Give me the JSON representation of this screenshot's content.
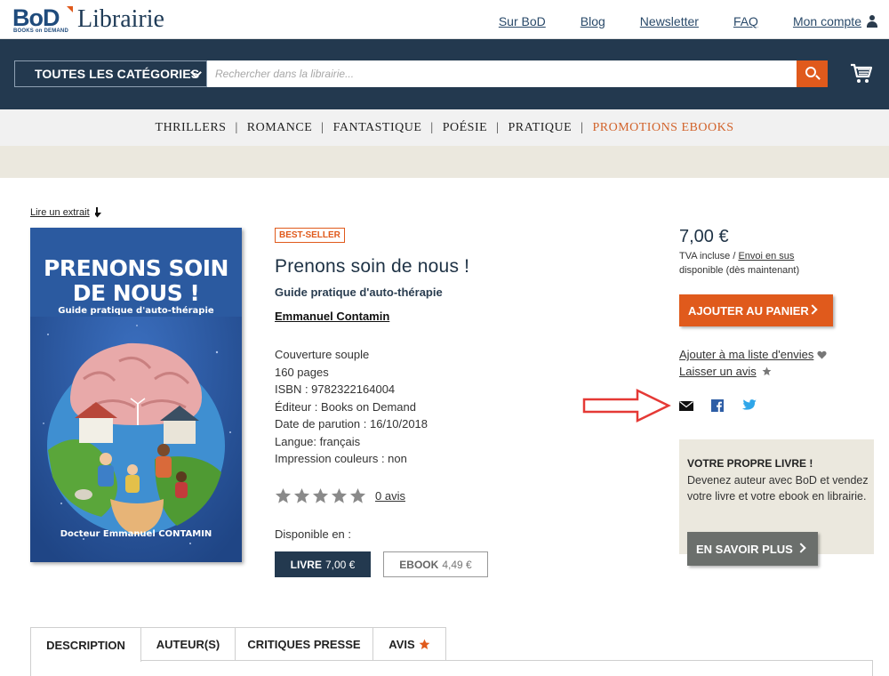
{
  "header": {
    "logo_brand": "BoD",
    "logo_sub": "BOOKS on DEMAND",
    "logo_title": "Librairie",
    "links": [
      "Sur BoD",
      "Blog",
      "Newsletter",
      "FAQ"
    ],
    "account_label": "Mon compte"
  },
  "search": {
    "category_label": "TOUTES LES CATÉGORIES",
    "placeholder": "Rechercher dans la librairie..."
  },
  "category_nav": {
    "items": [
      "THRILLERS",
      "ROMANCE",
      "FANTASTIQUE",
      "POÉSIE",
      "PRATIQUE"
    ],
    "separator": "|",
    "promo_item": "PROMOTIONS EBOOKS"
  },
  "product": {
    "excerpt_link": "Lire un extrait",
    "cover": {
      "title_line1": "PRENONS SOIN",
      "title_line2": "DE NOUS !",
      "subtitle": "Guide pratique d'auto-thérapie",
      "author": "Docteur Emmanuel CONTAMIN"
    },
    "badge": "BEST-SELLER",
    "title": "Prenons soin de nous !",
    "subtitle": "Guide pratique d'auto-thérapie",
    "author": "Emmanuel Contamin",
    "details": [
      "Couverture souple",
      "160 pages",
      "ISBN : 9782322164004",
      "Éditeur : Books on Demand",
      "Date de parution : 16/10/2018",
      "Langue: français",
      "Impression couleurs : non"
    ],
    "rating": {
      "stars_filled": 0,
      "stars_total": 5,
      "reviews_link": "0 avis"
    },
    "available_in_label": "Disponible en :",
    "formats": [
      {
        "name": "LIVRE",
        "price": "7,00 €",
        "selected": true
      },
      {
        "name": "EBOOK",
        "price": "4,49 €",
        "selected": false
      }
    ]
  },
  "purchase": {
    "price": "7,00 €",
    "tva_text": "TVA incluse / ",
    "shipping_link": "Envoi en sus",
    "availability": "disponible (dès maintenant)",
    "add_to_cart": "AJOUTER AU PANIER",
    "wishlist_link": "Ajouter à ma liste d'envies",
    "review_link": "Laisser un avis"
  },
  "share_icons": [
    "email-icon",
    "facebook-icon",
    "twitter-icon"
  ],
  "promo": {
    "title": "VOTRE PROPRE LIVRE !",
    "text": "Devenez auteur avec BoD et vendez votre livre et votre ebook en librairie.",
    "button": "EN SAVOIR PLUS"
  },
  "tabs": [
    {
      "label": "DESCRIPTION",
      "active": true
    },
    {
      "label": "AUTEUR(S)",
      "active": false
    },
    {
      "label": "CRITIQUES PRESSE",
      "active": false
    },
    {
      "label": "AVIS",
      "active": false
    }
  ],
  "colors": {
    "navy": "#23394f",
    "accent_orange": "#e05a1c",
    "beige": "#ebe8de",
    "annotation_red": "#e53935"
  }
}
